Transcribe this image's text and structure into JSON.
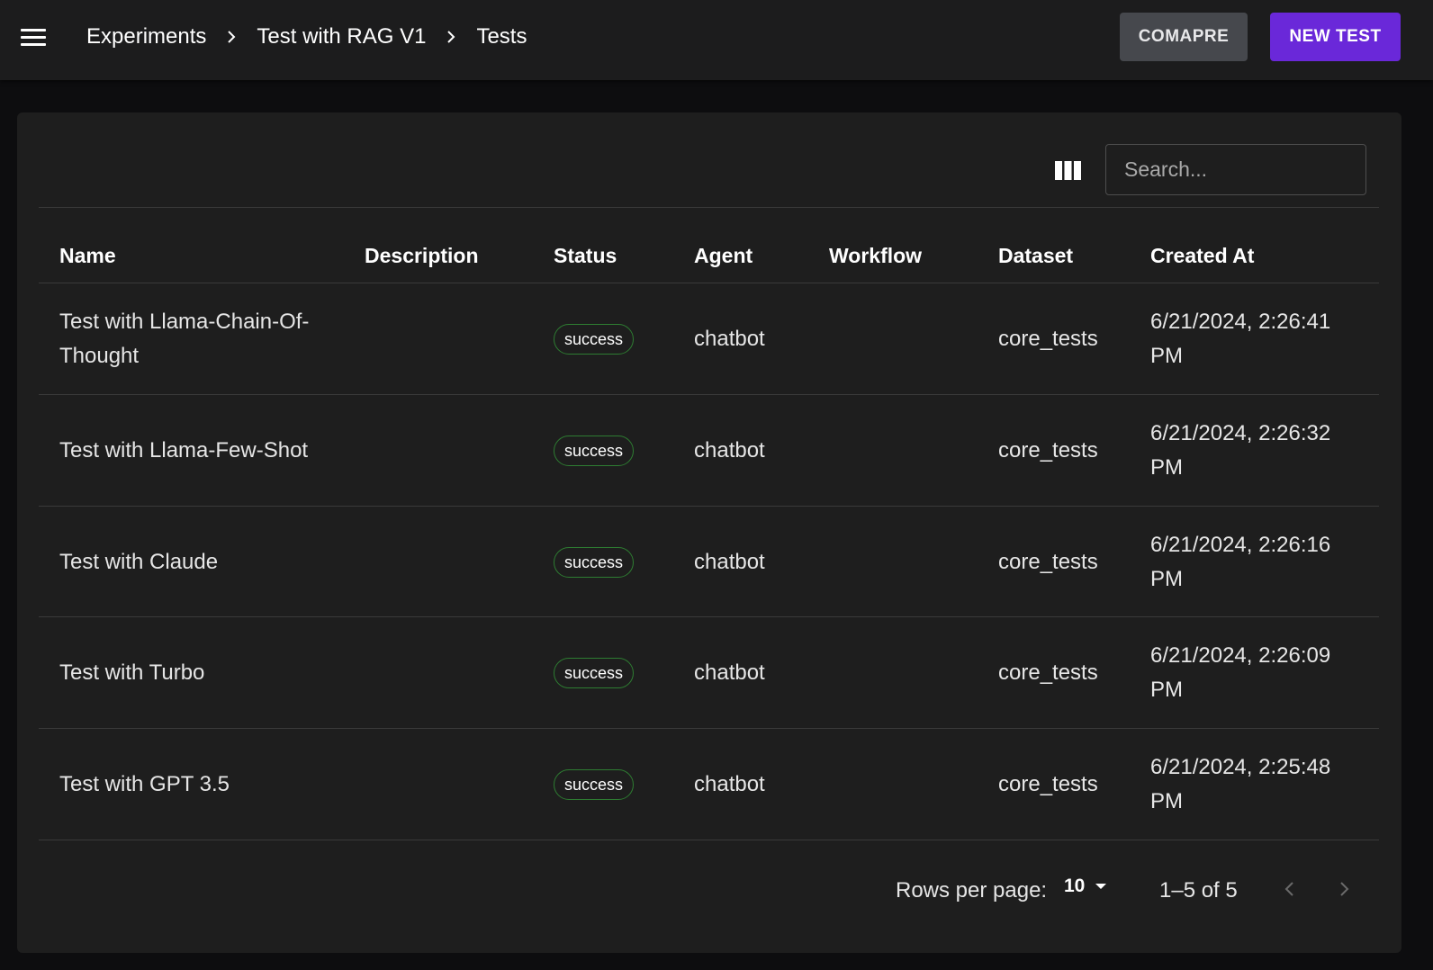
{
  "header": {
    "breadcrumbs": [
      "Experiments",
      "Test with RAG V1",
      "Tests"
    ],
    "compare_label": "COMAPRE",
    "new_test_label": "NEW TEST"
  },
  "colors": {
    "accent": "#6a28d9",
    "compare_bg": "#46484d",
    "success_border": "#2e7d32"
  },
  "toolbar": {
    "search_placeholder": "Search...",
    "columns_icon": "view-column-icon"
  },
  "table": {
    "columns": [
      "Name",
      "Description",
      "Status",
      "Agent",
      "Workflow",
      "Dataset",
      "Created At"
    ],
    "rows": [
      {
        "name": "Test with Llama-Chain-Of-Thought",
        "description": "",
        "status": "success",
        "agent": "chatbot",
        "workflow": "",
        "dataset": "core_tests",
        "created_at": "6/21/2024, 2:26:41 PM"
      },
      {
        "name": "Test with Llama-Few-Shot",
        "description": "",
        "status": "success",
        "agent": "chatbot",
        "workflow": "",
        "dataset": "core_tests",
        "created_at": "6/21/2024, 2:26:32 PM"
      },
      {
        "name": "Test with Claude",
        "description": "",
        "status": "success",
        "agent": "chatbot",
        "workflow": "",
        "dataset": "core_tests",
        "created_at": "6/21/2024, 2:26:16 PM"
      },
      {
        "name": "Test with Turbo",
        "description": "",
        "status": "success",
        "agent": "chatbot",
        "workflow": "",
        "dataset": "core_tests",
        "created_at": "6/21/2024, 2:26:09 PM"
      },
      {
        "name": "Test with GPT 3.5",
        "description": "",
        "status": "success",
        "agent": "chatbot",
        "workflow": "",
        "dataset": "core_tests",
        "created_at": "6/21/2024, 2:25:48 PM"
      }
    ]
  },
  "pagination": {
    "rows_per_page_label": "Rows per page:",
    "rows_per_page_value": "10",
    "range_label": "1–5 of 5"
  }
}
